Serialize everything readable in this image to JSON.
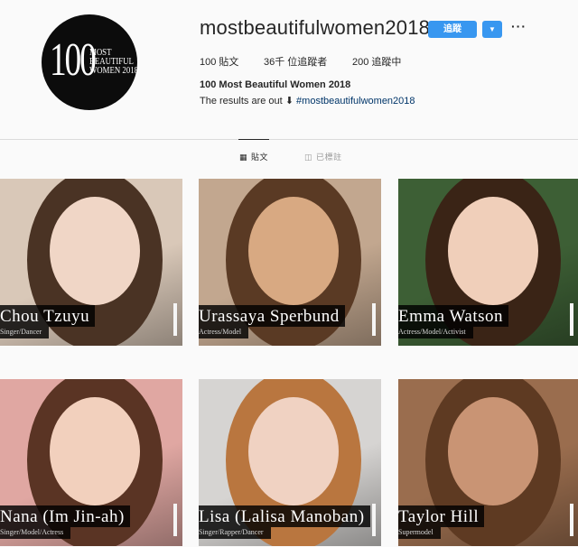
{
  "profile": {
    "avatar_number": "100",
    "avatar_lines": [
      "MOST",
      "BEAUTIFUL",
      "WOMEN 2018"
    ],
    "username": "mostbeautifulwomen2018",
    "follow_label": "追蹤",
    "dropdown_icon": "▼",
    "more_icon": "···",
    "stats": {
      "posts": "100 貼文",
      "followers": "36千 位追蹤者",
      "following": "200 追蹤中"
    },
    "full_name": "100 Most Beautiful Women 2018",
    "bio_text": "The results are out ⬇",
    "bio_hashtag": "#mostbeautifulwomen2018"
  },
  "tabs": [
    {
      "label": "貼文",
      "icon": "grid-icon",
      "active": true
    },
    {
      "label": "已標註",
      "icon": "tag-icon",
      "active": false
    }
  ],
  "posts": [
    {
      "name": "Chou Tzuyu",
      "role": "Singer/Dancer",
      "bg": "#d9c8b8",
      "hair": "#4a3324",
      "skin": "#f0d6c6"
    },
    {
      "name": "Urassaya Sperbund",
      "role": "Actress/Model",
      "bg": "#c2a78f",
      "hair": "#5a3a24",
      "skin": "#d8a982"
    },
    {
      "name": "Emma Watson",
      "role": "Actress/Model/Activist",
      "bg": "#3d5f35",
      "hair": "#3a2416",
      "skin": "#f0cfba"
    },
    {
      "name": "Nana (Im Jin-ah)",
      "role": "Singer/Model/Actress",
      "bg": "#e0a7a2",
      "hair": "#5a3424",
      "skin": "#f2d0bd"
    },
    {
      "name": "Lisa (Lalisa Manoban)",
      "role": "Singer/Rapper/Dancer",
      "bg": "#d6d4d2",
      "hair": "#b9763f",
      "skin": "#f0d2c2"
    },
    {
      "name": "Taylor Hill",
      "role": "Supermodel",
      "bg": "#9a6d4e",
      "hair": "#5e3a22",
      "skin": "#c99474"
    }
  ]
}
